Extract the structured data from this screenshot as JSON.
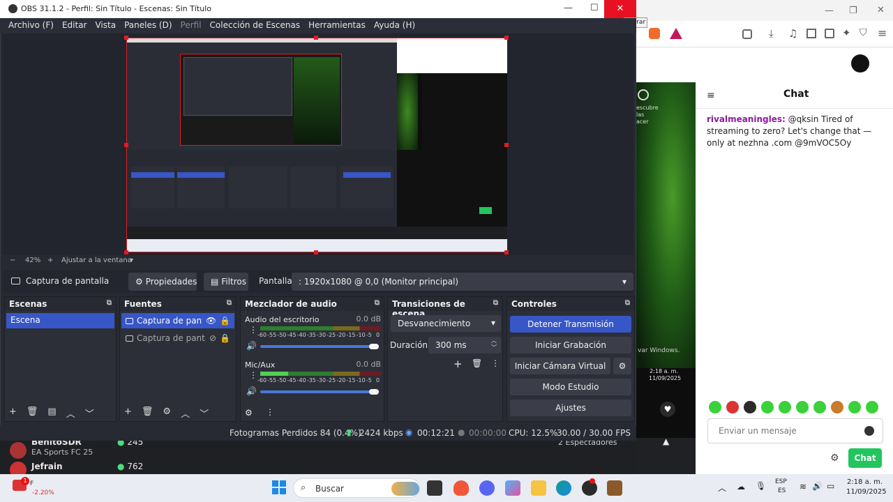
{
  "obs": {
    "title": "OBS 31.1.2 - Perfil: Sin Título - Escenas: Sin Título",
    "tooltip_close": "Cerrar",
    "menu": [
      "Archivo (F)",
      "Editar",
      "Vista",
      "Paneles (D)",
      "Perfil",
      "Colección de Escenas",
      "Herramientas",
      "Ayuda (H)"
    ],
    "zoom": {
      "minus": "−",
      "value": "42%",
      "plus": "+",
      "fit_label": "Ajustar a la ventana"
    },
    "source_bar": {
      "source_name": "Captura de pantalla",
      "properties_label": "Propiedades",
      "filters_label": "Filtros",
      "display_label": "Pantalla",
      "display_value": ": 1920x1080 @ 0,0 (Monitor principal)"
    },
    "scenes": {
      "title": "Escenas",
      "items": [
        "Escena"
      ]
    },
    "sources": {
      "title": "Fuentes",
      "items": [
        "Captura de pantall",
        "Captura de pantall"
      ]
    },
    "mixer": {
      "title": "Mezclador de audio",
      "channels": [
        {
          "name": "Audio del escritorio",
          "db": "0.0 dB",
          "level": 0.0
        },
        {
          "name": "Mic/Aux",
          "db": "0.0 dB",
          "level": 0.23
        }
      ],
      "scale": [
        "-60",
        "-55",
        "-50",
        "-45",
        "-40",
        "-35",
        "-30",
        "-25",
        "-20",
        "-15",
        "-10",
        "-5",
        "0"
      ]
    },
    "transitions": {
      "title": "Transiciones de escena",
      "type": "Desvanecimiento",
      "duration_label": "Duración",
      "duration_value": "300 ms"
    },
    "controls": {
      "title": "Controles",
      "stop_stream": "Detener Transmisión",
      "start_record": "Iniciar Grabación",
      "virtual_cam": "Iniciar Cámara Virtual",
      "studio_mode": "Modo Estudio",
      "settings": "Ajustes"
    },
    "status": {
      "dropped": "Fotogramas Perdidos 84 (0.4%)",
      "bitrate": "2424 kbps",
      "stream_time": "00:12:21",
      "record_time": "00:00:00",
      "cpu": "CPU: 12.5%",
      "fps": "30.00 / 30.00 FPS"
    }
  },
  "browser": {
    "chat_title": "Chat",
    "chat_message": {
      "user": "rivalmeaningles:",
      "text": " @qksin Tired of streaming to zero? Let's change that — only at nezhna .com @9mVOC5Oy"
    },
    "chat_placeholder": "Enviar un mensaje",
    "chat_button": "Chat",
    "viewers": "2 Espectadores",
    "windows_watermark": "var Windows.",
    "clock_overlay": {
      "time": "2:18 a. m.",
      "date": "11/09/2025"
    },
    "stream_cards": [
      {
        "name": "BenitoSDR",
        "game": "EA Sports FC 25",
        "viewers": "245"
      },
      {
        "name": "Jefrain",
        "game": "",
        "viewers": "762"
      }
    ]
  },
  "taskbar": {
    "weather_badge": "1",
    "weather_letter": "F",
    "weather_value": "-2.20%",
    "search_placeholder": "Buscar",
    "lang_top": "ESP",
    "lang_bottom": "ES",
    "time": "2:18 a. m.",
    "date": "11/09/2025"
  },
  "colors": {
    "accent": "#3756c7",
    "stream_red": "#e01b24",
    "chat_green": "#22c55e",
    "obs_bg": "#272a33"
  }
}
